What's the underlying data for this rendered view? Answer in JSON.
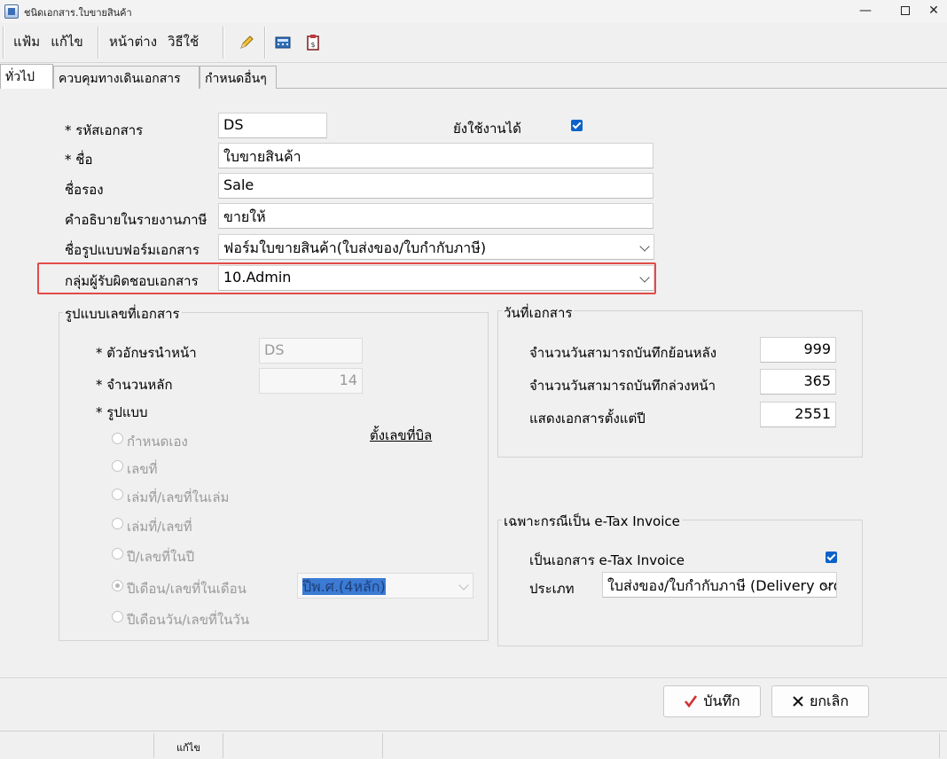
{
  "window": {
    "title": "ชนิดเอกสาร.ใบขายสินค้า"
  },
  "menu": {
    "file": "แฟ้ม",
    "edit": "แก้ไข",
    "window": "หน้าต่าง",
    "help": "วิธีใช้"
  },
  "tabs": [
    {
      "label": "ทั่วไป"
    },
    {
      "label": "ควบคุมทางเดินเอกสาร"
    },
    {
      "label": "กำหนดอื่นๆ"
    }
  ],
  "form": {
    "code_label": "* รหัสเอกสาร",
    "code_value": "DS",
    "active_label": "ยังใช้งานได้",
    "active_checked": true,
    "name_label": "* ชื่อ",
    "name_value": "ใบขายสินค้า",
    "subname_label": "ชื่อรอง",
    "subname_value": "Sale",
    "tax_desc_label": "คำอธิบายในรายงานภาษี",
    "tax_desc_value": "ขายให้",
    "form_label": "ชื่อรูปแบบฟอร์มเอกสาร",
    "form_value": "ฟอร์มใบขายสินค้า(ใบส่งของ/ใบกำกับภาษี)",
    "group_label": "กลุ่มผู้รับผิดชอบเอกสาร",
    "group_value": "10.Admin"
  },
  "doc_number": {
    "title": "รูปแบบเลขที่เอกสาร",
    "prefix_label": "* ตัวอักษรนำหน้า",
    "prefix_value": "DS",
    "digits_label": "* จำนวนหลัก",
    "digits_value": "14",
    "format_label": "* รูปแบบ",
    "set_link": "ตั้งเลขที่บิล",
    "options": [
      {
        "label": "กำหนดเอง",
        "checked": false
      },
      {
        "label": "เลขที่",
        "checked": false
      },
      {
        "label": "เล่มที่/เลขที่ในเล่ม",
        "checked": false
      },
      {
        "label": "เล่มที่/เลขที่",
        "checked": false
      },
      {
        "label": "ปี/เลขที่ในปี",
        "checked": false
      },
      {
        "label": "ปีเดือน/เลขที่ในเดือน",
        "checked": true
      },
      {
        "label": "ปีเดือนวัน/เลขที่ในวัน",
        "checked": false
      }
    ],
    "year_format": "ปีพ.ศ.(4หลัก)"
  },
  "doc_date": {
    "title": "วันที่เอกสาร",
    "back_label": "จำนวนวันสามารถบันทึกย้อนหลัง",
    "back_value": "999",
    "forward_label": "จำนวนวันสามารถบันทึกล่วงหน้า",
    "forward_value": "365",
    "since_label": "แสดงเอกสารตั้งแต่ปี",
    "since_value": "2551"
  },
  "etax": {
    "title": "เฉพาะกรณีเป็น e-Tax Invoice",
    "is_etax_label": "เป็นเอกสาร e-Tax Invoice",
    "is_etax_checked": true,
    "type_label": "ประเภท",
    "type_value": "ใบส่งของ/ใบกำกับภาษี (Delivery order/Tax Invoice)"
  },
  "buttons": {
    "save": "บันทึก",
    "cancel": "ยกเลิก"
  },
  "status": {
    "mode": "แก้ไข"
  },
  "colors": {
    "highlight": "#e34b4b",
    "checkbox": "#0b63c9"
  }
}
